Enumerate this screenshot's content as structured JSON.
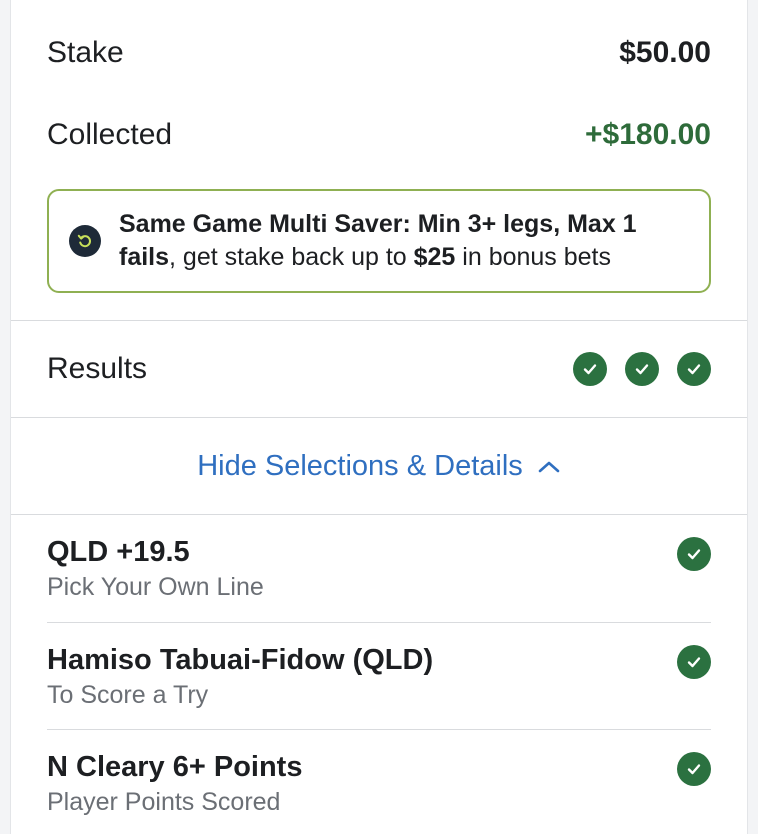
{
  "summary": {
    "stake_label": "Stake",
    "stake_value": "$50.00",
    "collected_label": "Collected",
    "collected_value": "+$180.00"
  },
  "promo": {
    "icon": "refresh-icon",
    "bold_part": "Same Game Multi Saver: Min 3+ legs, Max 1 fails",
    "text_part_1": ", get stake back up to ",
    "amount": "$25",
    "text_part_2": " in bonus bets"
  },
  "results": {
    "label": "Results",
    "legs_won": 3
  },
  "toggle": {
    "label": "Hide Selections & Details",
    "icon": "chevron-up-icon"
  },
  "selections": [
    {
      "title": "QLD +19.5",
      "subtitle": "Pick Your Own Line",
      "status": "won"
    },
    {
      "title": "Hamiso Tabuai-Fidow (QLD)",
      "subtitle": "To Score a Try",
      "status": "won"
    },
    {
      "title": "N Cleary 6+ Points",
      "subtitle": "Player Points Scored",
      "status": "won"
    }
  ],
  "colors": {
    "win_green": "#2b7140",
    "collected_green": "#2e6b3a",
    "promo_border": "#8fb052",
    "link_blue": "#2f6fc0"
  }
}
